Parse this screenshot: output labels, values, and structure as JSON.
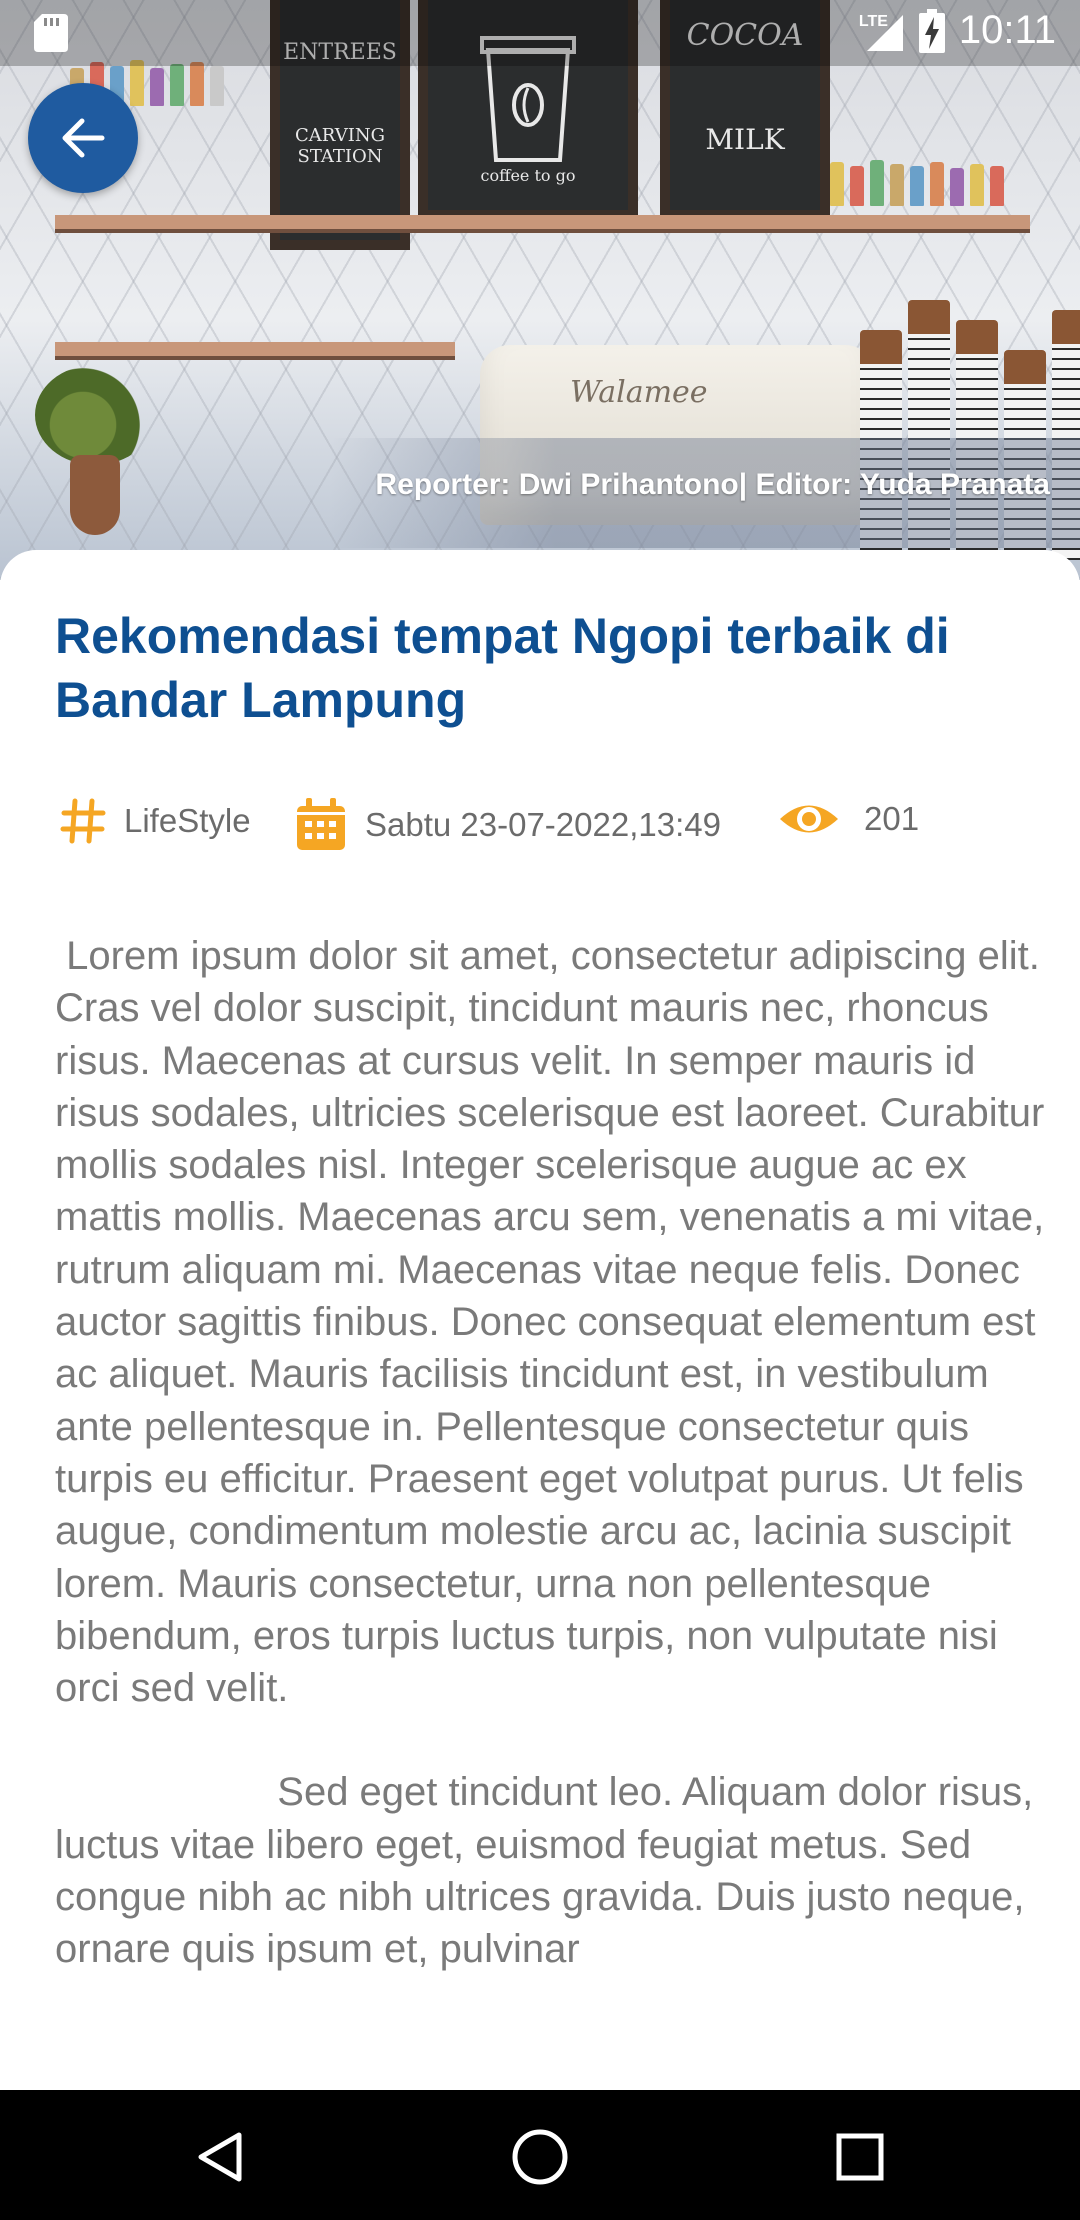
{
  "status_bar": {
    "network": "LTE",
    "time": "10:11"
  },
  "hero": {
    "credit": "Reporter: Dwi Prihantono| Editor: Yuda Pranata",
    "board_left": [
      "ENTREES",
      "CARVING STATION"
    ],
    "board_center": "coffee to go",
    "board_right": [
      "COCOA",
      "MILK"
    ],
    "machine_brand": "Walamee"
  },
  "article": {
    "title": "Rekomendasi tempat Ngopi terbaik di Bandar Lampung",
    "category": "LifeStyle",
    "date": "Sabtu 23-07-2022,13:49",
    "views": "201",
    "paragraphs": [
      " Lorem ipsum dolor sit amet, consectetur adipiscing elit. Cras vel dolor suscipit, tincidunt mauris nec, rhoncus risus. Maecenas at cursus velit. In semper mauris id risus sodales, ultricies scelerisque est laoreet. Curabitur mollis sodales nisl. Integer scelerisque augue ac ex mattis mollis. Maecenas arcu sem, venenatis a mi vitae, rutrum aliquam mi. Maecenas vitae neque felis. Donec auctor sagittis finibus. Donec consequat elementum est ac aliquet. Mauris facilisis tincidunt est, in vestibulum ante pellentesque in. Pellentesque consectetur quis turpis eu efficitur. Praesent eget volutpat purus. Ut felis augue, condimentum molestie arcu ac, lacinia suscipit lorem. Mauris consectetur, urna non pellentesque bibendum, eros turpis luctus turpis, non vulputate nisi orci sed velit.",
      "                    Sed eget tincidunt leo. Aliquam dolor risus, luctus vitae libero eget, euismod feugiat metus. Sed congue nibh ac nibh ultrices gravida. Duis justo neque, ornare quis ipsum et, pulvinar"
    ]
  },
  "icons": {
    "back": "arrow-left-icon",
    "category": "hashtag-icon",
    "date": "calendar-icon",
    "views": "eye-icon",
    "nav_back": "triangle-back-icon",
    "nav_home": "circle-home-icon",
    "nav_recents": "square-recents-icon"
  },
  "colors": {
    "title": "#0e4f91",
    "accent": "#f5a623",
    "back_button": "#1f5ba0",
    "body_text": "#7a7a7a",
    "meta_text": "#6b6b6b",
    "nav_bar": "#000000"
  }
}
